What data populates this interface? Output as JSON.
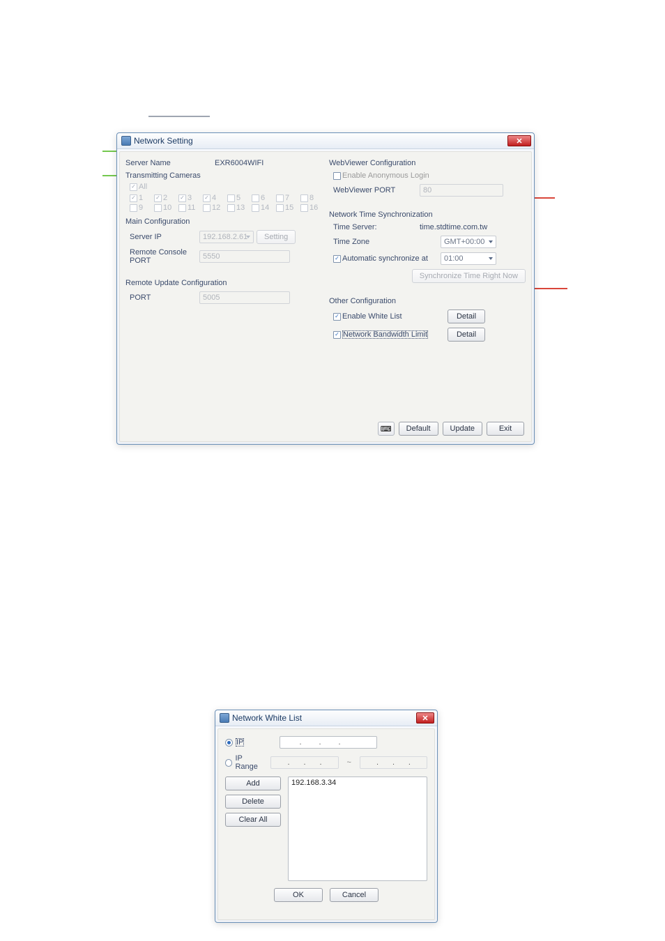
{
  "network_setting": {
    "title": "Network Setting",
    "left": {
      "server_name_label": "Server Name",
      "server_name_value": "EXR6004WIFI",
      "transmitting_cameras_label": "Transmitting Cameras",
      "all_label": "All",
      "all_checked": true,
      "cameras": [
        {
          "n": "1",
          "checked": true
        },
        {
          "n": "2",
          "checked": true
        },
        {
          "n": "3",
          "checked": true
        },
        {
          "n": "4",
          "checked": true
        },
        {
          "n": "5",
          "checked": false
        },
        {
          "n": "6",
          "checked": false
        },
        {
          "n": "7",
          "checked": false
        },
        {
          "n": "8",
          "checked": false
        },
        {
          "n": "9",
          "checked": false
        },
        {
          "n": "10",
          "checked": false
        },
        {
          "n": "11",
          "checked": false
        },
        {
          "n": "12",
          "checked": false
        },
        {
          "n": "13",
          "checked": false
        },
        {
          "n": "14",
          "checked": false
        },
        {
          "n": "15",
          "checked": false
        },
        {
          "n": "16",
          "checked": false
        }
      ],
      "main_cfg_label": "Main Configuration",
      "server_ip_label": "Server IP",
      "server_ip_value": "192.168.2.61",
      "server_ip_setting_btn": "Setting",
      "remote_console_port_label": "Remote Console PORT",
      "remote_console_port_value": "5550",
      "remote_update_cfg_label": "Remote Update Configuration",
      "port_label": "PORT",
      "port_value": "5005"
    },
    "right": {
      "webviewer_cfg_label": "WebViewer Configuration",
      "anon_login_label": "Enable Anonymous Login",
      "anon_login_checked": false,
      "webviewer_port_label": "WebViewer PORT",
      "webviewer_port_value": "80",
      "nts_label": "Network Time Synchronization",
      "time_server_label": "Time Server:",
      "time_server_value": "time.stdtime.com.tw",
      "time_zone_label": "Time Zone",
      "time_zone_value": "GMT+00:00",
      "auto_sync_label": "Automatic synchronize at",
      "auto_sync_checked": true,
      "auto_sync_time": "01:00",
      "sync_now_btn": "Synchronize Time Right Now",
      "other_cfg_label": "Other Configuration",
      "enable_white_list_label": "Enable White List",
      "enable_white_list_checked": true,
      "white_list_detail_btn": "Detail",
      "bandwidth_limit_label": "Network Bandwidth Limit",
      "bandwidth_limit_checked": true,
      "bandwidth_limit_detail_btn": "Detail"
    },
    "bottom": {
      "default_btn": "Default",
      "update_btn": "Update",
      "exit_btn": "Exit"
    }
  },
  "white_list": {
    "title": "Network White List",
    "ip_radio_label": "IP",
    "ip_radio_selected": true,
    "ip_range_radio_label": "IP Range",
    "add_btn": "Add",
    "delete_btn": "Delete",
    "clear_all_btn": "Clear All",
    "list_item": "192.168.3.34",
    "ok_btn": "OK",
    "cancel_btn": "Cancel"
  }
}
